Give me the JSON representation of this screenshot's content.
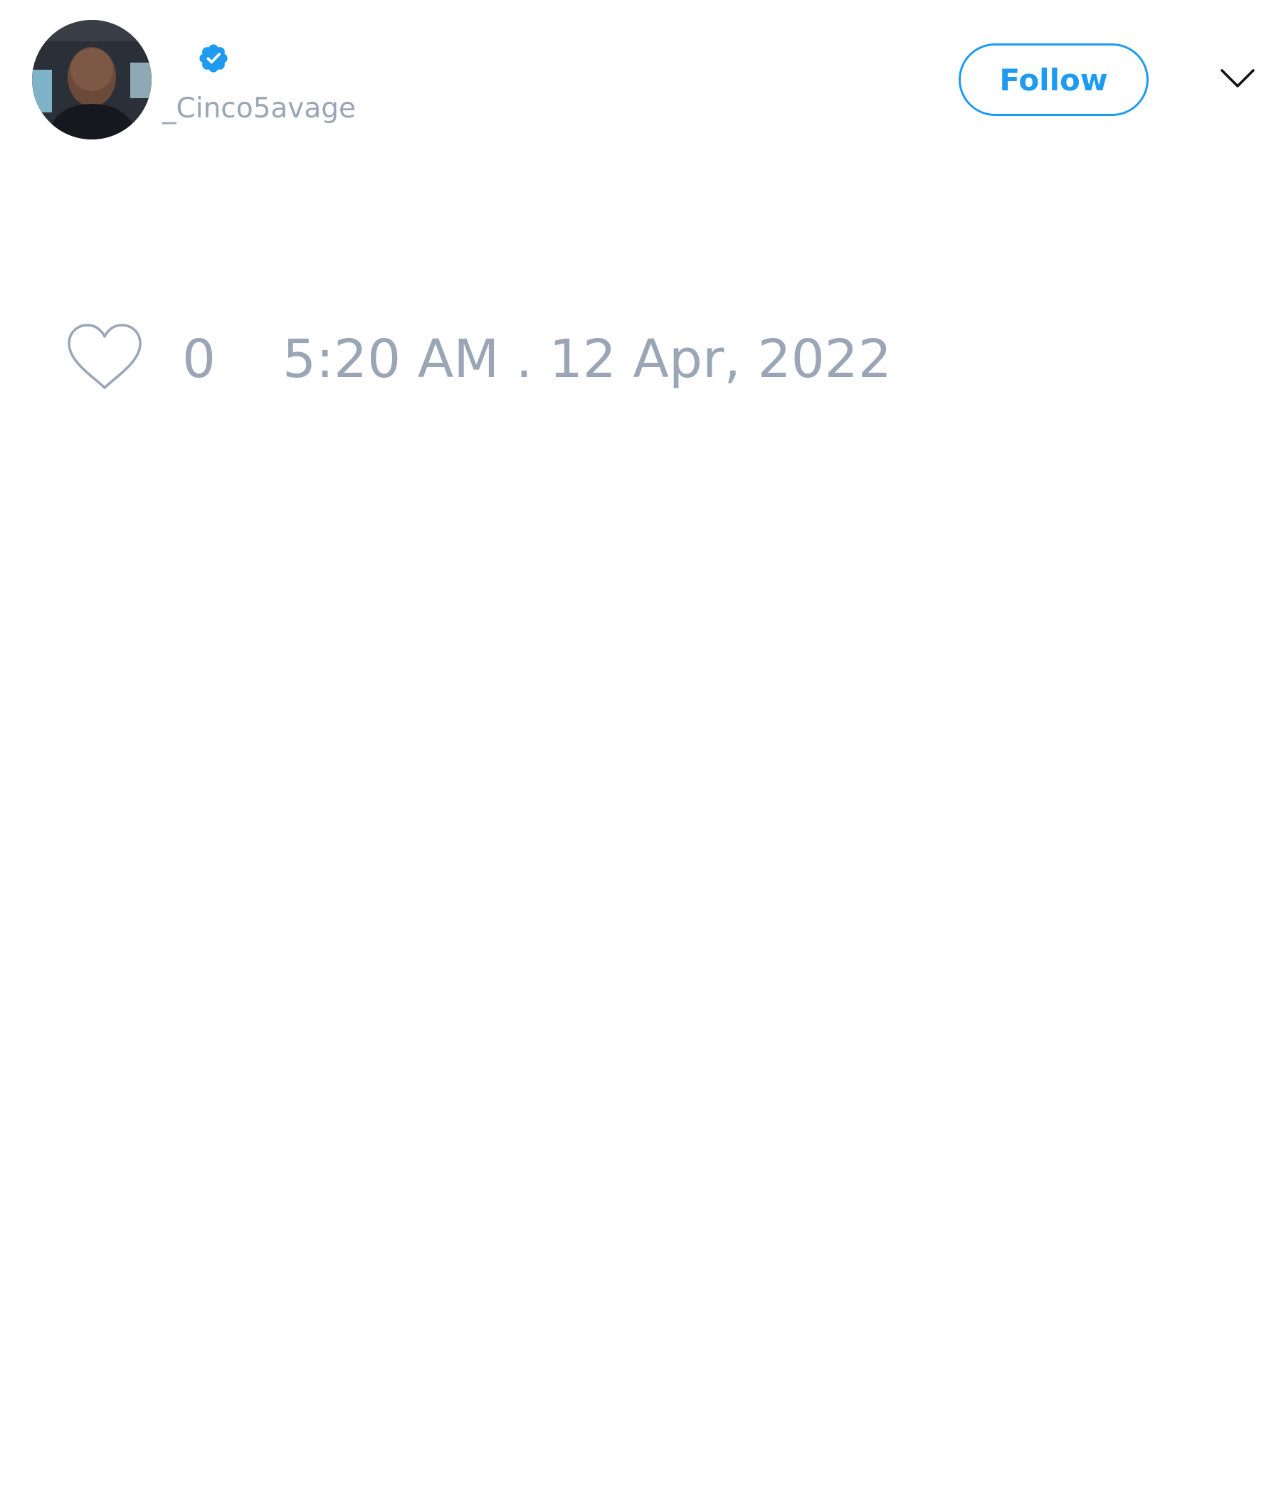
{
  "author": {
    "handle": "_Cinco5avage",
    "verified": true,
    "avatar": "profile-photo"
  },
  "header": {
    "follow_label": "Follow",
    "menu_icon": "chevron-down-icon"
  },
  "stats": {
    "like_icon": "heart-outline-icon",
    "like_count": "0",
    "timestamp": "5:20 AM . 12 Apr, 2022"
  },
  "colors": {
    "accent": "#1d9bf0",
    "muted_text": "#9aa6b5",
    "background": "#ffffff"
  }
}
